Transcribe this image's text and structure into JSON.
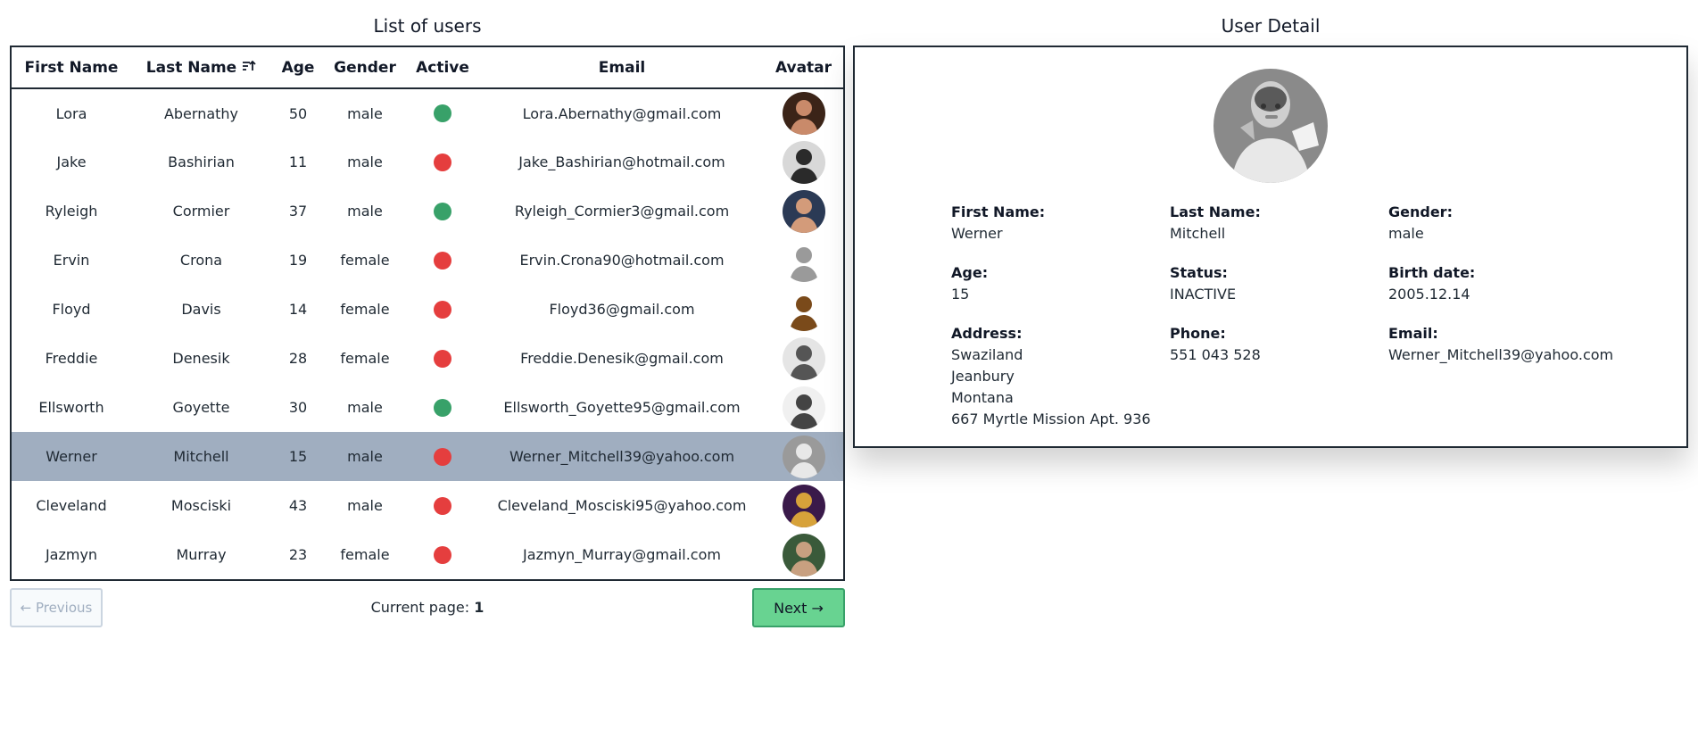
{
  "list": {
    "title": "List of users",
    "columns": [
      "First Name",
      "Last Name",
      "Age",
      "Gender",
      "Active",
      "Email",
      "Avatar"
    ],
    "rows": [
      {
        "first": "Lora",
        "last": "Abernathy",
        "age": "50",
        "gender": "male",
        "active": true,
        "email": "Lora.Abernathy@gmail.com"
      },
      {
        "first": "Jake",
        "last": "Bashirian",
        "age": "11",
        "gender": "male",
        "active": false,
        "email": "Jake_Bashirian@hotmail.com"
      },
      {
        "first": "Ryleigh",
        "last": "Cormier",
        "age": "37",
        "gender": "male",
        "active": true,
        "email": "Ryleigh_Cormier3@gmail.com"
      },
      {
        "first": "Ervin",
        "last": "Crona",
        "age": "19",
        "gender": "female",
        "active": false,
        "email": "Ervin.Crona90@hotmail.com"
      },
      {
        "first": "Floyd",
        "last": "Davis",
        "age": "14",
        "gender": "female",
        "active": false,
        "email": "Floyd36@gmail.com"
      },
      {
        "first": "Freddie",
        "last": "Denesik",
        "age": "28",
        "gender": "female",
        "active": false,
        "email": "Freddie.Denesik@gmail.com"
      },
      {
        "first": "Ellsworth",
        "last": "Goyette",
        "age": "30",
        "gender": "male",
        "active": true,
        "email": "Ellsworth_Goyette95@gmail.com"
      },
      {
        "first": "Werner",
        "last": "Mitchell",
        "age": "15",
        "gender": "male",
        "active": false,
        "email": "Werner_Mitchell39@yahoo.com",
        "selected": true
      },
      {
        "first": "Cleveland",
        "last": "Mosciski",
        "age": "43",
        "gender": "male",
        "active": false,
        "email": "Cleveland_Mosciski95@yahoo.com"
      },
      {
        "first": "Jazmyn",
        "last": "Murray",
        "age": "23",
        "gender": "female",
        "active": false,
        "email": "Jazmyn_Murray@gmail.com"
      }
    ],
    "sorted_column": "Last Name",
    "sort_icon": "sort-ascending-icon"
  },
  "pagination": {
    "prev_label": "← Previous",
    "current_label": "Current page:",
    "current_page": "1",
    "next_label": "Next →"
  },
  "detail": {
    "title": "User Detail",
    "first_name_label": "First Name:",
    "first_name": "Werner",
    "last_name_label": "Last Name:",
    "last_name": "Mitchell",
    "gender_label": "Gender:",
    "gender": "male",
    "age_label": "Age:",
    "age": "15",
    "status_label": "Status:",
    "status": "INACTIVE",
    "birth_label": "Birth date:",
    "birth": "2005.12.14",
    "address_label": "Address:",
    "address": [
      "Swaziland",
      "Jeanbury",
      "Montana",
      "667 Myrtle Mission Apt. 936"
    ],
    "phone_label": "Phone:",
    "phone": "551 043 528",
    "email_label": "Email:",
    "email": "Werner_Mitchell39@yahoo.com"
  },
  "colors": {
    "active": "#38a169",
    "inactive": "#e53e3e",
    "selected_row": "#a0aec0",
    "next_button": "#68d391"
  }
}
